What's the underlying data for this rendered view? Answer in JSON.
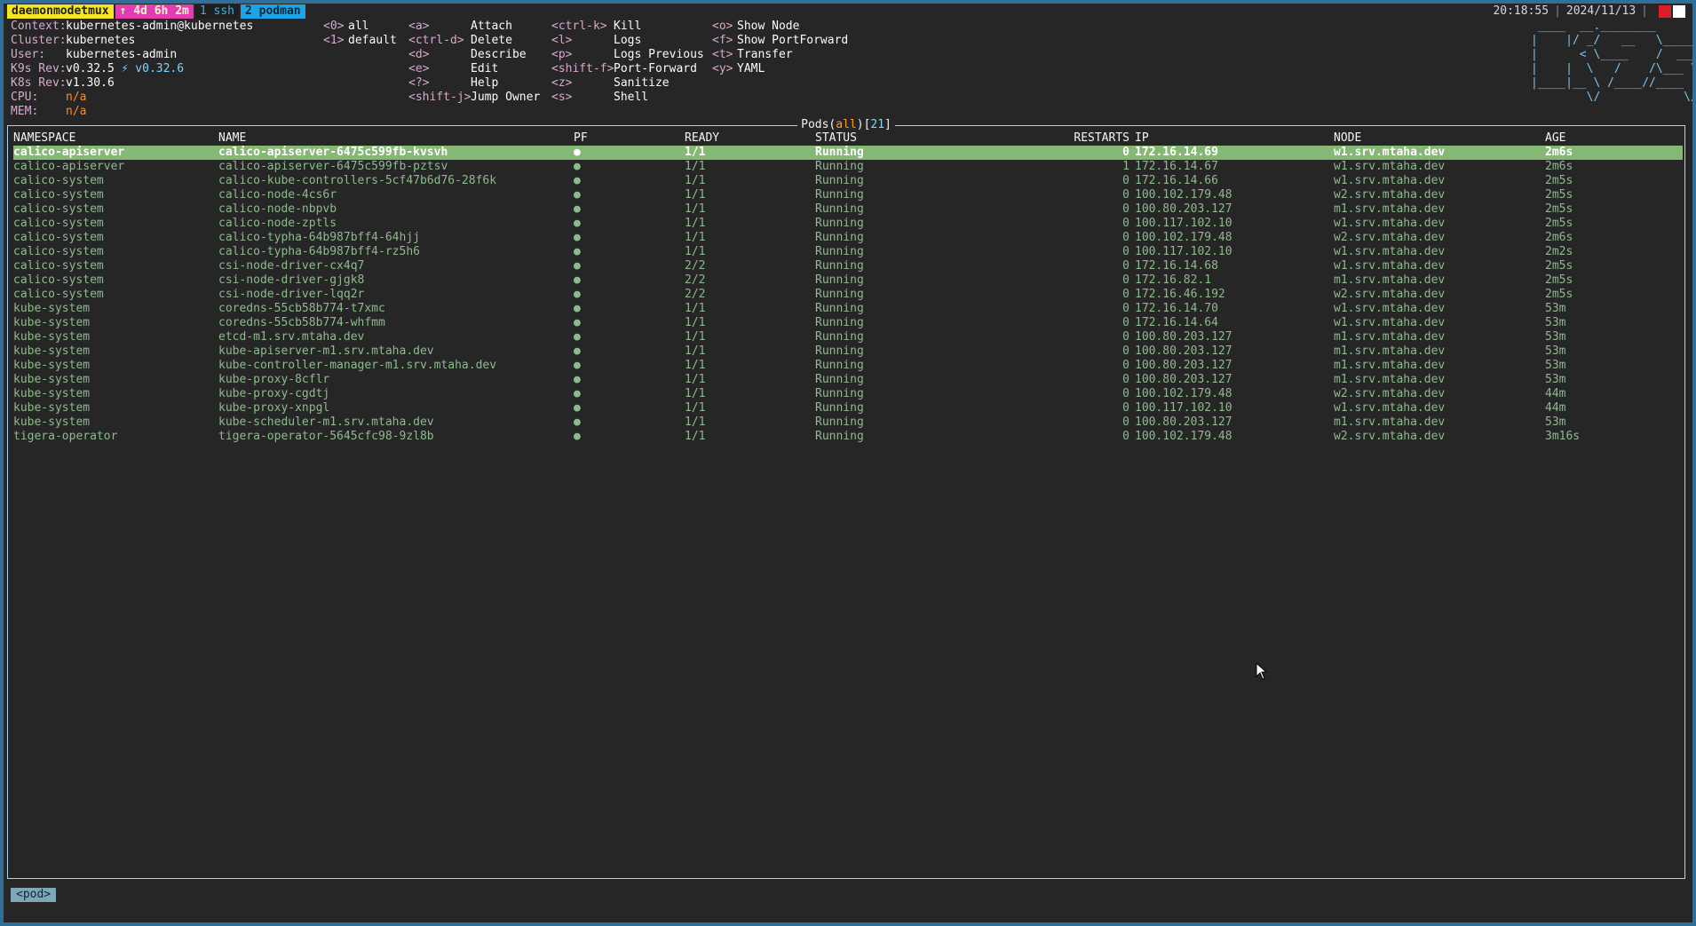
{
  "tmux": {
    "session": "daemonmodetmux",
    "uptime": "↑ 4d 6h 2m",
    "win1": "1 ssh",
    "win2": "2 podman",
    "clock": "20:18:55",
    "date": "2024/11/13"
  },
  "info": [
    {
      "key": "Context:",
      "value": "kubernetes-admin@kubernetes"
    },
    {
      "key": "Cluster:",
      "value": "kubernetes"
    },
    {
      "key": "User:",
      "value": "kubernetes-admin"
    },
    {
      "key": "K9s Rev:",
      "value": "v0.32.5",
      "extra": "⚡ v0.32.6"
    },
    {
      "key": "K8s Rev:",
      "value": "v1.30.6"
    },
    {
      "key": "CPU:",
      "value": "n/a"
    },
    {
      "key": "MEM:",
      "value": "n/a"
    }
  ],
  "namespaces": [
    {
      "key": "<0>",
      "desc": "all"
    },
    {
      "key": "<1>",
      "desc": "default"
    }
  ],
  "shortcuts1": [
    {
      "key": "<a>",
      "desc": "Attach"
    },
    {
      "key": "<ctrl-d>",
      "desc": "Delete"
    },
    {
      "key": "<d>",
      "desc": "Describe"
    },
    {
      "key": "<e>",
      "desc": "Edit"
    },
    {
      "key": "<?>",
      "desc": "Help"
    },
    {
      "key": "<shift-j>",
      "desc": "Jump Owner"
    }
  ],
  "shortcuts2": [
    {
      "key": "<ctrl-k>",
      "desc": "Kill"
    },
    {
      "key": "<l>",
      "desc": "Logs"
    },
    {
      "key": "<p>",
      "desc": "Logs Previous"
    },
    {
      "key": "<shift-f>",
      "desc": "Port-Forward"
    },
    {
      "key": "<z>",
      "desc": "Sanitize"
    },
    {
      "key": "<s>",
      "desc": "Shell"
    }
  ],
  "shortcuts3": [
    {
      "key": "<o>",
      "desc": "Show Node"
    },
    {
      "key": "<f>",
      "desc": "Show PortForward"
    },
    {
      "key": "<t>",
      "desc": "Transfer"
    },
    {
      "key": "<y>",
      "desc": "YAML"
    }
  ],
  "logo": [
    " ____  __.________       ",
    "|    |/ _/   __   \\______",
    "|      < \\____    /  ___/",
    "|    |  \\   /    /\\___ \\ ",
    "|____|__ \\ /____//____  >",
    "        \\/            \\/ "
  ],
  "table": {
    "title_prefix": "Pods(",
    "filter": "all",
    "title_mid": ")[",
    "count": "21",
    "title_suffix": "]",
    "headers": [
      "NAMESPACE",
      "NAME",
      "PF",
      "READY",
      "STATUS",
      "RESTARTS",
      "IP",
      "NODE",
      "AGE"
    ],
    "rows": [
      [
        "calico-apiserver",
        "calico-apiserver-6475c599fb-kvsvh",
        "●",
        "1/1",
        "Running",
        "0",
        "172.16.14.69",
        "w1.srv.mtaha.dev",
        "2m6s"
      ],
      [
        "calico-apiserver",
        "calico-apiserver-6475c599fb-pztsv",
        "●",
        "1/1",
        "Running",
        "1",
        "172.16.14.67",
        "w1.srv.mtaha.dev",
        "2m6s"
      ],
      [
        "calico-system",
        "calico-kube-controllers-5cf47b6d76-28f6k",
        "●",
        "1/1",
        "Running",
        "0",
        "172.16.14.66",
        "w1.srv.mtaha.dev",
        "2m5s"
      ],
      [
        "calico-system",
        "calico-node-4cs6r",
        "●",
        "1/1",
        "Running",
        "0",
        "100.102.179.48",
        "w2.srv.mtaha.dev",
        "2m5s"
      ],
      [
        "calico-system",
        "calico-node-nbpvb",
        "●",
        "1/1",
        "Running",
        "0",
        "100.80.203.127",
        "m1.srv.mtaha.dev",
        "2m5s"
      ],
      [
        "calico-system",
        "calico-node-zptls",
        "●",
        "1/1",
        "Running",
        "0",
        "100.117.102.10",
        "w1.srv.mtaha.dev",
        "2m5s"
      ],
      [
        "calico-system",
        "calico-typha-64b987bff4-64hjj",
        "●",
        "1/1",
        "Running",
        "0",
        "100.102.179.48",
        "w2.srv.mtaha.dev",
        "2m6s"
      ],
      [
        "calico-system",
        "calico-typha-64b987bff4-rz5h6",
        "●",
        "1/1",
        "Running",
        "0",
        "100.117.102.10",
        "w1.srv.mtaha.dev",
        "2m2s"
      ],
      [
        "calico-system",
        "csi-node-driver-cx4q7",
        "●",
        "2/2",
        "Running",
        "0",
        "172.16.14.68",
        "w1.srv.mtaha.dev",
        "2m5s"
      ],
      [
        "calico-system",
        "csi-node-driver-gjgk8",
        "●",
        "2/2",
        "Running",
        "0",
        "172.16.82.1",
        "m1.srv.mtaha.dev",
        "2m5s"
      ],
      [
        "calico-system",
        "csi-node-driver-lqq2r",
        "●",
        "2/2",
        "Running",
        "0",
        "172.16.46.192",
        "w2.srv.mtaha.dev",
        "2m5s"
      ],
      [
        "kube-system",
        "coredns-55cb58b774-t7xmc",
        "●",
        "1/1",
        "Running",
        "0",
        "172.16.14.70",
        "w1.srv.mtaha.dev",
        "53m"
      ],
      [
        "kube-system",
        "coredns-55cb58b774-whfmm",
        "●",
        "1/1",
        "Running",
        "0",
        "172.16.14.64",
        "w1.srv.mtaha.dev",
        "53m"
      ],
      [
        "kube-system",
        "etcd-m1.srv.mtaha.dev",
        "●",
        "1/1",
        "Running",
        "0",
        "100.80.203.127",
        "m1.srv.mtaha.dev",
        "53m"
      ],
      [
        "kube-system",
        "kube-apiserver-m1.srv.mtaha.dev",
        "●",
        "1/1",
        "Running",
        "0",
        "100.80.203.127",
        "m1.srv.mtaha.dev",
        "53m"
      ],
      [
        "kube-system",
        "kube-controller-manager-m1.srv.mtaha.dev",
        "●",
        "1/1",
        "Running",
        "0",
        "100.80.203.127",
        "m1.srv.mtaha.dev",
        "53m"
      ],
      [
        "kube-system",
        "kube-proxy-8cflr",
        "●",
        "1/1",
        "Running",
        "0",
        "100.80.203.127",
        "m1.srv.mtaha.dev",
        "53m"
      ],
      [
        "kube-system",
        "kube-proxy-cgdtj",
        "●",
        "1/1",
        "Running",
        "0",
        "100.102.179.48",
        "w2.srv.mtaha.dev",
        "44m"
      ],
      [
        "kube-system",
        "kube-proxy-xnpgl",
        "●",
        "1/1",
        "Running",
        "0",
        "100.117.102.10",
        "w1.srv.mtaha.dev",
        "44m"
      ],
      [
        "kube-system",
        "kube-scheduler-m1.srv.mtaha.dev",
        "●",
        "1/1",
        "Running",
        "0",
        "100.80.203.127",
        "m1.srv.mtaha.dev",
        "53m"
      ],
      [
        "tigera-operator",
        "tigera-operator-5645cfc98-9zl8b",
        "●",
        "1/1",
        "Running",
        "0",
        "100.102.179.48",
        "w2.srv.mtaha.dev",
        "3m16s"
      ]
    ]
  },
  "breadcrumb": "<pod>",
  "colors": {
    "selected_row": "#85b775",
    "row_text": "#8fb98f",
    "border": "#a8d6ec",
    "tmux_session": "#f6e620",
    "tmux_uptime": "#e33bb0",
    "tmux_window": "#1da4e3"
  }
}
